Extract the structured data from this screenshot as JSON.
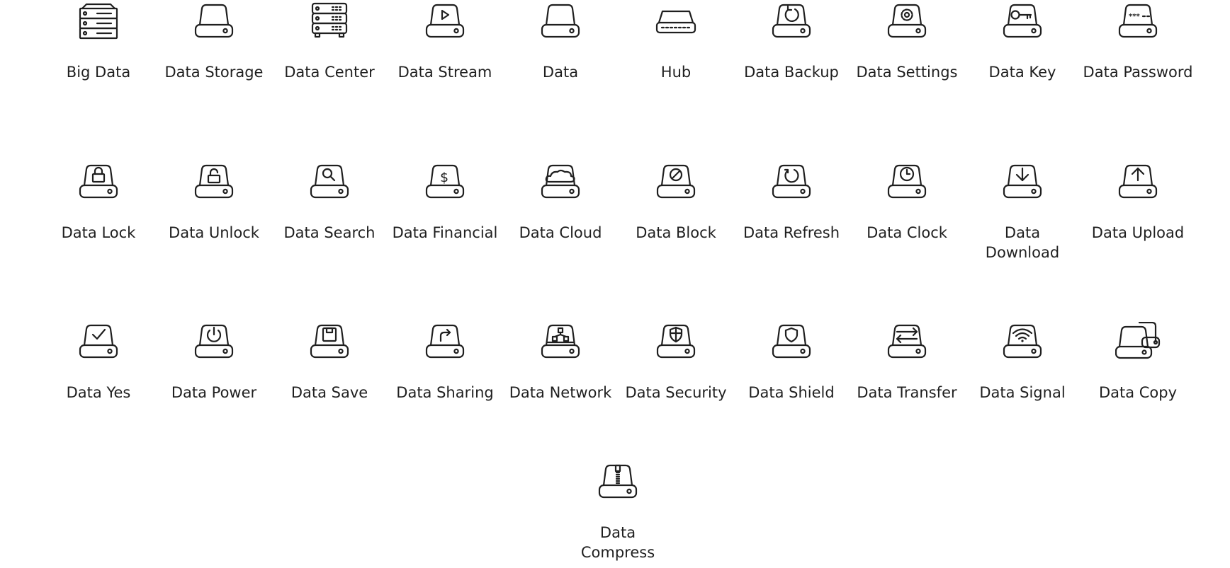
{
  "icons": [
    {
      "id": "big-data",
      "label": "Big Data"
    },
    {
      "id": "data-storage",
      "label": "Data Storage"
    },
    {
      "id": "data-center",
      "label": "Data Center"
    },
    {
      "id": "data-stream",
      "label": "Data Stream"
    },
    {
      "id": "data",
      "label": "Data"
    },
    {
      "id": "hub",
      "label": "Hub"
    },
    {
      "id": "data-backup",
      "label": "Data Backup"
    },
    {
      "id": "data-settings",
      "label": "Data Settings"
    },
    {
      "id": "data-key",
      "label": "Data Key"
    },
    {
      "id": "data-password",
      "label": "Data Password"
    },
    {
      "id": "data-lock",
      "label": "Data Lock"
    },
    {
      "id": "data-unlock",
      "label": "Data Unlock"
    },
    {
      "id": "data-search",
      "label": "Data Search"
    },
    {
      "id": "data-financial",
      "label": "Data Financial"
    },
    {
      "id": "data-cloud",
      "label": "Data Cloud"
    },
    {
      "id": "data-block",
      "label": "Data Block"
    },
    {
      "id": "data-refresh",
      "label": "Data Refresh"
    },
    {
      "id": "data-clock",
      "label": "Data Clock"
    },
    {
      "id": "data-download",
      "label": "Data Download"
    },
    {
      "id": "data-upload",
      "label": "Data Upload"
    },
    {
      "id": "data-yes",
      "label": "Data Yes"
    },
    {
      "id": "data-power",
      "label": "Data Power"
    },
    {
      "id": "data-save",
      "label": "Data Save"
    },
    {
      "id": "data-sharing",
      "label": "Data Sharing"
    },
    {
      "id": "data-network",
      "label": "Data Network"
    },
    {
      "id": "data-security",
      "label": "Data Security"
    },
    {
      "id": "data-shield",
      "label": "Data Shield"
    },
    {
      "id": "data-transfer",
      "label": "Data Transfer"
    },
    {
      "id": "data-signal",
      "label": "Data Signal"
    },
    {
      "id": "data-copy",
      "label": "Data Copy"
    },
    {
      "id": "data-compress",
      "label": "Data Compress"
    }
  ],
  "colors": {
    "stroke": "#1f1f1f",
    "background": "#ffffff"
  }
}
